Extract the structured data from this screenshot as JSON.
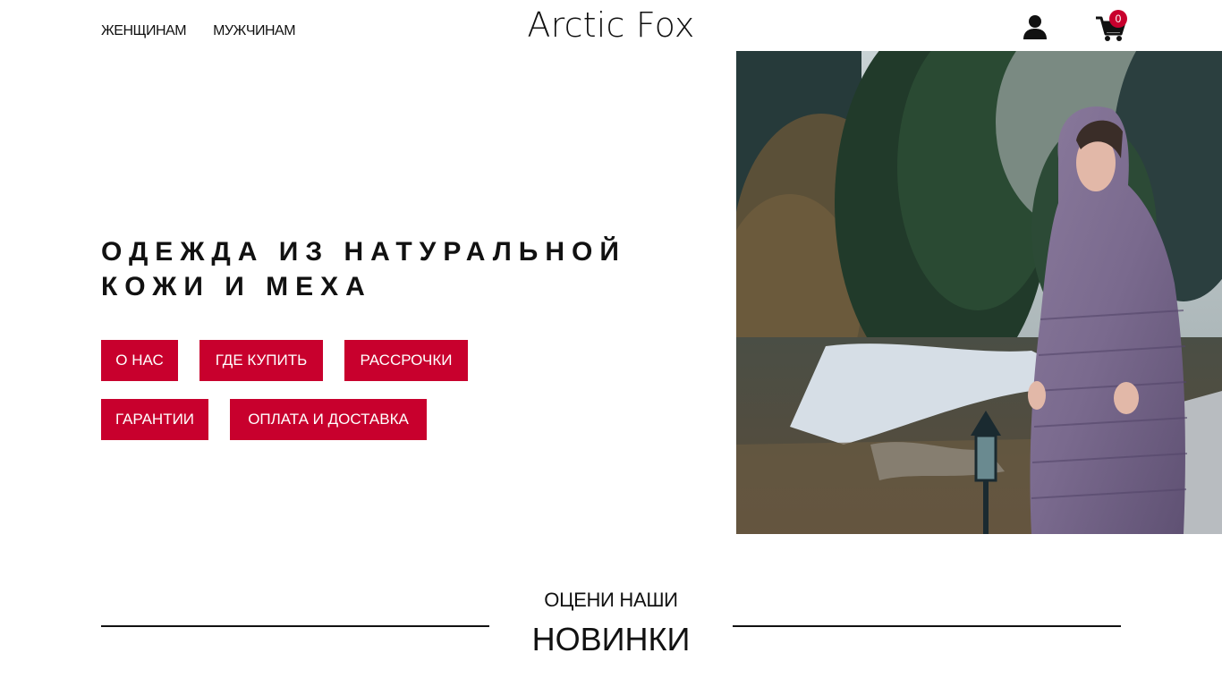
{
  "header": {
    "nav": [
      "ЖЕНЩИНАМ",
      "МУЖЧИНАМ"
    ],
    "logo": "Arctic Fox",
    "cart_count": "0",
    "icons": [
      "user-icon",
      "cart-icon"
    ]
  },
  "hero": {
    "title_line1": "ОДЕЖДА ИЗ НАТУРАЛЬНОЙ",
    "title_line2": "КОЖИ И МЕХА",
    "buttons": [
      "О НАС",
      "ГДЕ КУПИТЬ",
      "РАССРОЧКИ",
      "ГАРАНТИИ",
      "ОПЛАТА И ДОСТАВКА"
    ]
  },
  "section": {
    "subtitle": "ОЦЕНИ НАШИ",
    "title": "НОВИНКИ"
  },
  "colors": {
    "accent": "#c8002d",
    "text": "#111111",
    "background": "#ffffff"
  }
}
